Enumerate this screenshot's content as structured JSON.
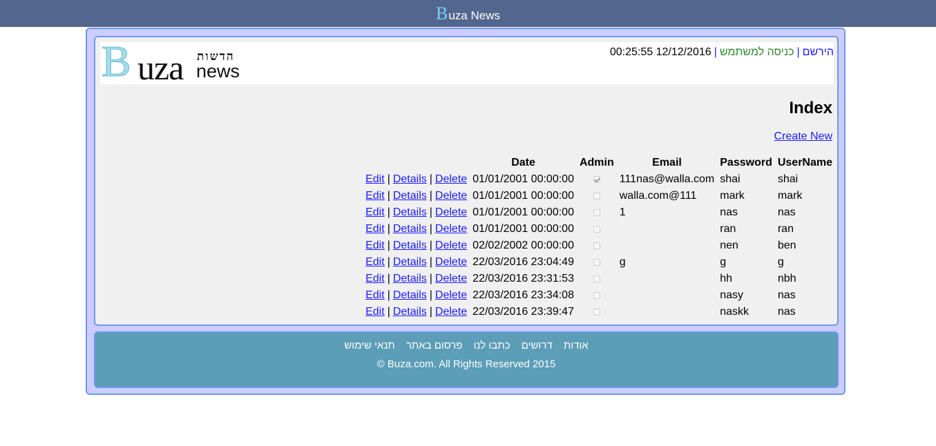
{
  "topbar": {
    "brand_initial": "B",
    "brand_rest": "uza News"
  },
  "logo": {
    "initial": "B",
    "rest": "uza",
    "hebrew": "הדשות",
    "news": "news"
  },
  "userbar": {
    "register": "הירשם",
    "separator": "|",
    "login": "כניסה למשתמש",
    "datetime": "12/12/2016 00:25:55"
  },
  "page": {
    "title": "Index",
    "create_new": "Create New"
  },
  "table": {
    "headers": {
      "username": "UserName",
      "password": "Password",
      "email": "Email",
      "admin": "Admin",
      "date": "Date"
    },
    "actions": {
      "edit": "Edit",
      "details": "Details",
      "delete": "Delete",
      "separator": "|"
    },
    "rows": [
      {
        "username": "shai",
        "password": "shai",
        "email": "111nas@walla.com",
        "admin": true,
        "date": "01/01/2001 00:00:00"
      },
      {
        "username": "mark",
        "password": "mark",
        "email": "walla.com@111",
        "admin": false,
        "date": "01/01/2001 00:00:00"
      },
      {
        "username": "nas",
        "password": "nas",
        "email": "1",
        "admin": false,
        "date": "01/01/2001 00:00:00"
      },
      {
        "username": "ran",
        "password": "ran",
        "email": "",
        "admin": false,
        "date": "01/01/2001 00:00:00"
      },
      {
        "username": "ben",
        "password": "nen",
        "email": "",
        "admin": false,
        "date": "02/02/2002 00:00:00"
      },
      {
        "username": "g",
        "password": "g",
        "email": "g",
        "admin": false,
        "date": "22/03/2016 23:04:49"
      },
      {
        "username": "nbh",
        "password": "hh",
        "email": "",
        "admin": false,
        "date": "22/03/2016 23:31:53"
      },
      {
        "username": "nas",
        "password": "nasy",
        "email": "",
        "admin": false,
        "date": "22/03/2016 23:34:08"
      },
      {
        "username": "nas",
        "password": "naskk",
        "email": "",
        "admin": false,
        "date": "22/03/2016 23:39:47"
      }
    ]
  },
  "footer": {
    "links": [
      "אודות",
      "דרושים",
      "כתבו לנו",
      "פרסום באתר",
      "תנאי שימוש"
    ],
    "copyright": "© Buza.com. All Rights Reserved 2015"
  }
}
